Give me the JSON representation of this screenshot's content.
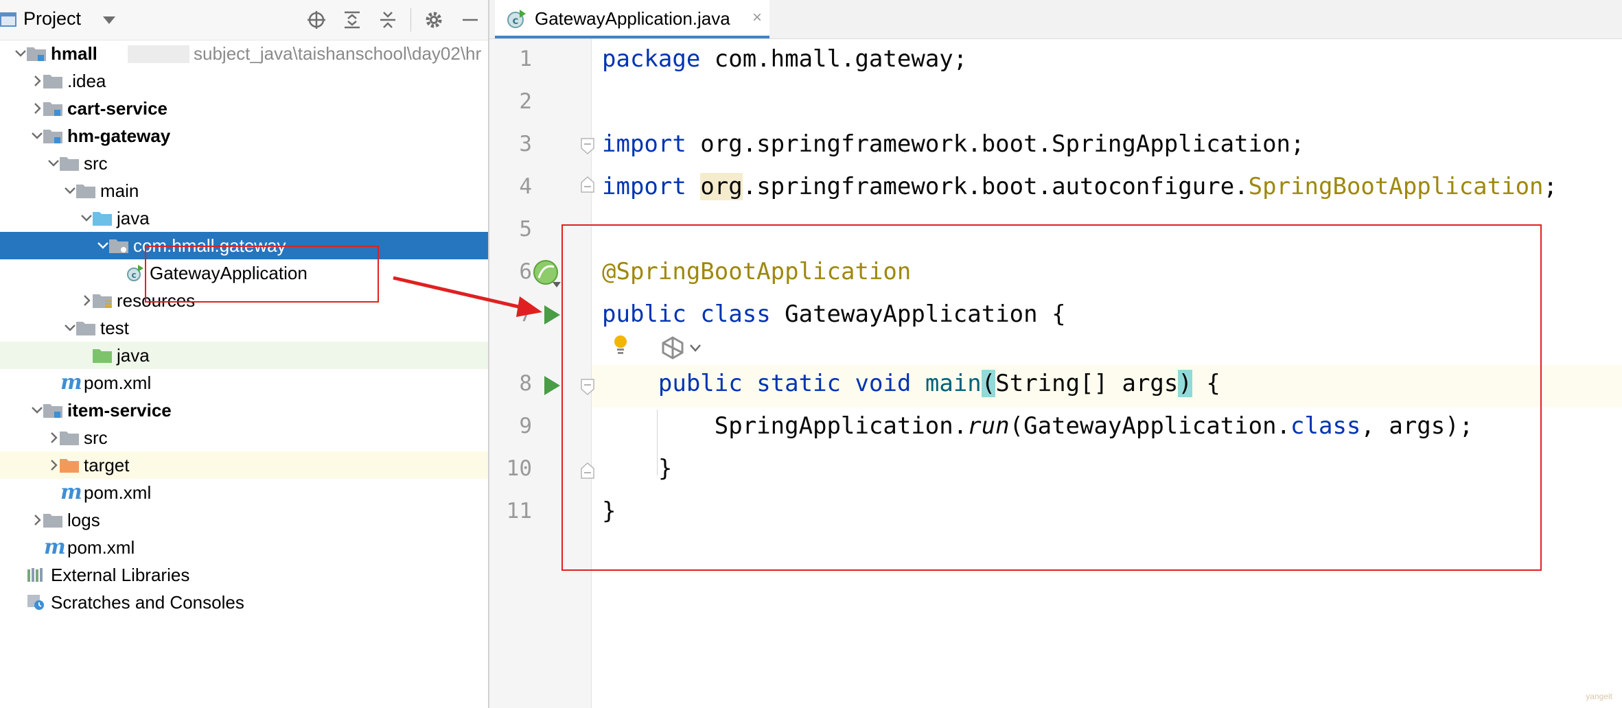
{
  "panel": {
    "title": "Project",
    "tree": [
      {
        "label": "hmall",
        "path": "subject_java\\taishanschool\\day02\\hr",
        "level": 0,
        "expanded": true,
        "icon": "module-folder-icon",
        "bold": true
      },
      {
        "label": ".idea",
        "level": 1,
        "expanded": false,
        "icon": "folder-icon"
      },
      {
        "label": "cart-service",
        "level": 1,
        "expanded": false,
        "icon": "module-folder-icon",
        "bold": true
      },
      {
        "label": "hm-gateway",
        "level": 1,
        "expanded": true,
        "icon": "module-folder-icon",
        "bold": true
      },
      {
        "label": "src",
        "level": 2,
        "expanded": true,
        "icon": "folder-icon"
      },
      {
        "label": "main",
        "level": 3,
        "expanded": true,
        "icon": "folder-icon"
      },
      {
        "label": "java",
        "level": 4,
        "expanded": true,
        "icon": "source-folder-icon"
      },
      {
        "label": "com.hmall.gateway",
        "level": 5,
        "expanded": true,
        "icon": "package-icon",
        "selected": true
      },
      {
        "label": "GatewayApplication",
        "level": 6,
        "icon": "spring-class-icon"
      },
      {
        "label": "resources",
        "level": 4,
        "expanded": false,
        "icon": "resources-folder-icon"
      },
      {
        "label": "test",
        "level": 3,
        "expanded": true,
        "icon": "folder-icon"
      },
      {
        "label": "java",
        "level": 4,
        "icon": "test-folder-icon",
        "highlight": "green"
      },
      {
        "label": "pom.xml",
        "level": 2,
        "icon": "maven-icon"
      },
      {
        "label": "item-service",
        "level": 1,
        "expanded": true,
        "icon": "module-folder-icon",
        "bold": true
      },
      {
        "label": "src",
        "level": 2,
        "expanded": false,
        "icon": "folder-icon"
      },
      {
        "label": "target",
        "level": 2,
        "expanded": false,
        "icon": "excluded-folder-icon",
        "highlight": "yellow"
      },
      {
        "label": "pom.xml",
        "level": 2,
        "icon": "maven-icon"
      },
      {
        "label": "logs",
        "level": 1,
        "expanded": false,
        "icon": "folder-icon"
      },
      {
        "label": "pom.xml",
        "level": 1,
        "icon": "maven-icon"
      },
      {
        "label": "External Libraries",
        "level": 0,
        "icon": "libraries-icon"
      },
      {
        "label": "Scratches and Consoles",
        "level": 0,
        "icon": "scratches-icon"
      }
    ]
  },
  "editor": {
    "tab": {
      "label": "GatewayApplication.java",
      "close": "×",
      "icon": "spring-class-icon"
    },
    "lines": [
      {
        "n": "1",
        "tokens": [
          {
            "t": "package",
            "c": "kw"
          },
          {
            "t": " com.hmall.gateway;"
          }
        ]
      },
      {
        "n": "2",
        "tokens": []
      },
      {
        "n": "3",
        "tokens": [
          {
            "t": "import",
            "c": "kw"
          },
          {
            "t": " org.springframework.boot.SpringApplication;"
          }
        ]
      },
      {
        "n": "4",
        "tokens": [
          {
            "t": "import",
            "c": "kw"
          },
          {
            "t": " "
          },
          {
            "t": "org",
            "c": "hl-tan"
          },
          {
            "t": ".springframework.boot.autoconfigure."
          },
          {
            "t": "SpringBootApplication",
            "c": "ann"
          },
          {
            "t": ";"
          }
        ]
      },
      {
        "n": "5",
        "tokens": []
      },
      {
        "n": "6",
        "tokens": [
          {
            "t": "@SpringBootApplication",
            "c": "ann"
          }
        ]
      },
      {
        "n": "7",
        "tokens": [
          {
            "t": "public",
            "c": "kw"
          },
          {
            "t": " "
          },
          {
            "t": "class",
            "c": "kw"
          },
          {
            "t": " GatewayApplication {"
          }
        ]
      },
      {
        "n": "8",
        "tokens": [
          {
            "t": "    "
          },
          {
            "t": "public",
            "c": "kw"
          },
          {
            "t": " "
          },
          {
            "t": "static",
            "c": "kw"
          },
          {
            "t": " "
          },
          {
            "t": "void",
            "c": "kw"
          },
          {
            "t": " "
          },
          {
            "t": "main",
            "c": "fn"
          },
          {
            "t": "(",
            "c": "hl-teal"
          },
          {
            "t": "String[] args"
          },
          {
            "t": ")",
            "c": "hl-teal"
          },
          {
            "t": " {"
          }
        ]
      },
      {
        "n": "9",
        "tokens": [
          {
            "t": "        SpringApplication."
          },
          {
            "t": "run",
            "c": "it"
          },
          {
            "t": "(GatewayApplication."
          },
          {
            "t": "class",
            "c": "kw"
          },
          {
            "t": ", args);"
          }
        ]
      },
      {
        "n": "10",
        "tokens": [
          {
            "t": "    }"
          }
        ]
      },
      {
        "n": "11",
        "tokens": [
          {
            "t": "}"
          }
        ]
      }
    ],
    "gutter_icons": [
      {
        "line": "6",
        "icon": "spring-bean-icon"
      },
      {
        "line": "7",
        "icon": "run-icon"
      },
      {
        "line": "8",
        "icon": "run-icon"
      }
    ],
    "inlay_icons": [
      "intention-bulb-icon",
      "ai-assistant-icon"
    ]
  },
  "annotations": {
    "color": "#e02020",
    "arrow": "arrow-icon"
  },
  "watermark": "yangeit"
}
